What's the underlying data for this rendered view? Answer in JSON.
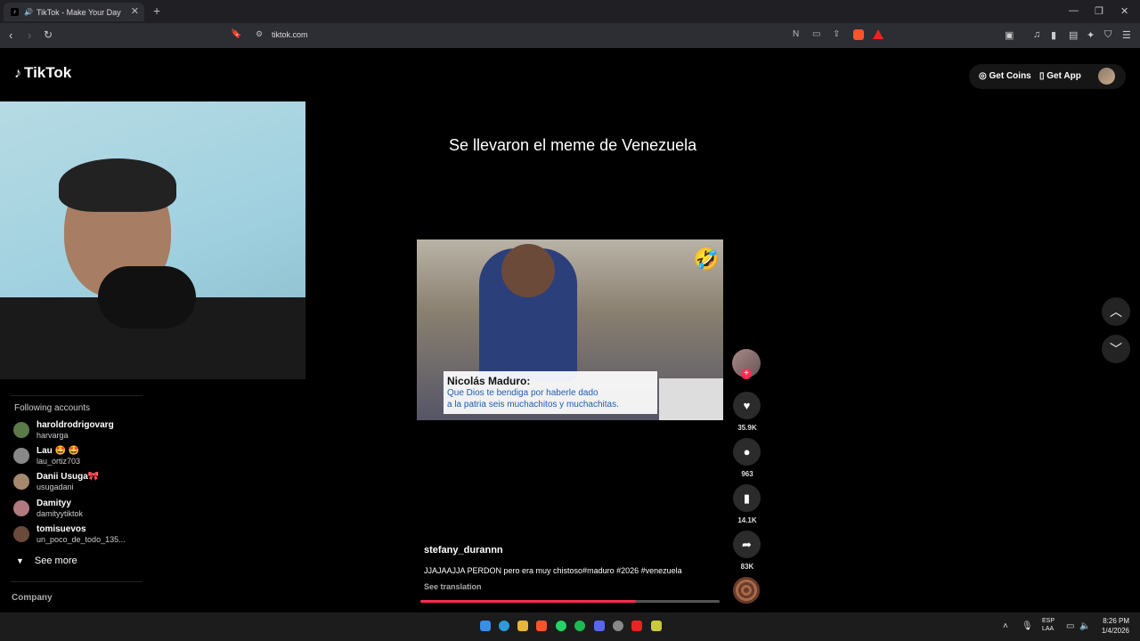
{
  "browser": {
    "tab_title": "TikTok - Make Your Day",
    "new_tab": "+",
    "url": "tiktok.com"
  },
  "header": {
    "logo_text": "TikTok",
    "get_coins": "Get Coins",
    "get_app": "Get App"
  },
  "video": {
    "headline": "Se llevaron el meme de Venezuela",
    "subtitle_name": "Nicolás Maduro:",
    "subtitle_line1": "Que Dios te bendiga por haberle dado",
    "subtitle_line2": "a la patria seis muchachitos y muchachitas.",
    "author": "stefany_durannn",
    "caption": "JJAJAAJJA PERDON pero era muy chistoso#maduro #2026 #venezuela",
    "see_translation": "See translation",
    "progress": 0.72
  },
  "actions": {
    "likes": "35.9K",
    "comments": "963",
    "saves": "14.1K",
    "shares": "83K"
  },
  "sidebar": {
    "following_title": "Following accounts",
    "accounts": [
      {
        "name": "haroldrodrigovarg",
        "handle": "harvarga",
        "color": "#5a7a4a"
      },
      {
        "name": "Lau 🤩 🤩",
        "handle": "lau_ortiz703",
        "color": "#888"
      },
      {
        "name": "Danii Usuga🎀",
        "handle": "usugadani",
        "color": "#a58870"
      },
      {
        "name": "Damityy",
        "handle": "damityytiktok",
        "color": "#b07a80"
      },
      {
        "name": "tomisuevos",
        "handle": "un_poco_de_todo_135...",
        "color": "#6a4a3a"
      }
    ],
    "see_more": "See more",
    "company": "Company"
  },
  "taskbar": {
    "lang_line1": "ESP",
    "lang_line2": "LAA",
    "time": "8:26 PM",
    "date": "1/4/2026"
  }
}
